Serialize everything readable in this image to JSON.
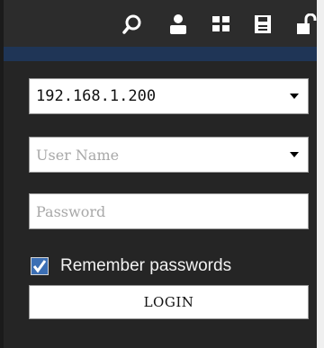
{
  "toolbar": {
    "icons": [
      "search-icon",
      "user-icon",
      "grid-icon",
      "save-icon",
      "unlock-icon"
    ]
  },
  "form": {
    "server_address": "192.168.1.200",
    "username_placeholder": "User Name",
    "password_placeholder": "Password",
    "remember_label": "Remember passwords",
    "remember_checked": true,
    "login_label": "LOGIN"
  },
  "colors": {
    "panel_bg": "#2b2b2b",
    "divider": "#1f3556",
    "checkbox": "#3c6fb4",
    "text_light": "#f2f2f2"
  }
}
